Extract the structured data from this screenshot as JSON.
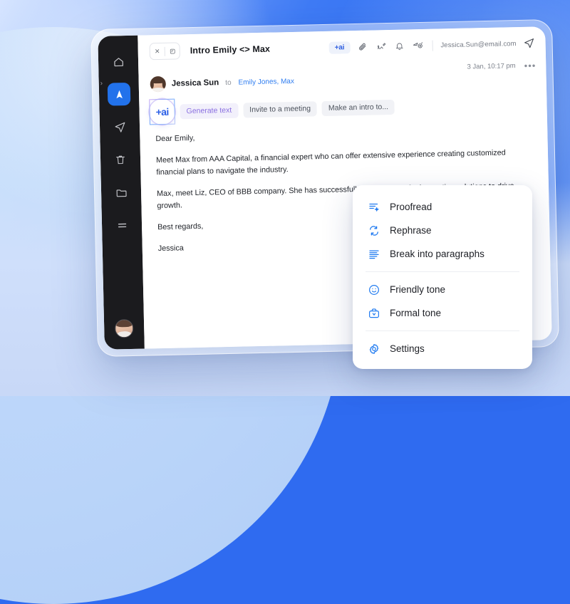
{
  "app": {
    "window_title": "Intro Emily <> Max"
  },
  "sidebar": {
    "items": [
      {
        "id": "home",
        "icon": "home-icon",
        "active": false
      },
      {
        "id": "inbox",
        "icon": "navigator-icon",
        "active": true
      },
      {
        "id": "sent",
        "icon": "send-icon",
        "active": false
      },
      {
        "id": "trash",
        "icon": "trash-icon",
        "active": false
      },
      {
        "id": "folders",
        "icon": "folder-icon",
        "active": false
      },
      {
        "id": "menu",
        "icon": "hamburger-menu-icon",
        "active": false
      }
    ],
    "caret": "›",
    "avatar_alt": "user-avatar"
  },
  "topbar": {
    "close_label": "✕",
    "collapse_icon": "collapse-icon",
    "title": "Intro Emily <> Max",
    "ai_badge": "+ai",
    "icons": [
      "attachment-icon",
      "signature-icon",
      "notification-bell-icon",
      "read-tracking-icon"
    ],
    "email": "Jessica.Sun@email.com",
    "send_icon": "send-icon"
  },
  "message": {
    "date": "3 Jan, 10:17 pm",
    "more": "•••",
    "sender": "Jessica Sun",
    "to_label": "to",
    "recipients": "Emily Jones, Max",
    "body": [
      "Dear Emily,",
      "Meet Max from AAA Capital, a financial expert who can offer extensive experience creating customized financial plans to navigate the industry.",
      "Max, meet Liz, CEO of BBB company. She has successfully been looking for innovative solutions to drive growth.",
      "Best regards,",
      "Jessica"
    ]
  },
  "chips": {
    "orb_label": "+ai",
    "items": [
      {
        "label": "Generate text",
        "style": "gen"
      },
      {
        "label": "Invite to a meeting",
        "style": "plain"
      },
      {
        "label": "Make an intro to...",
        "style": "plain"
      }
    ]
  },
  "dropdown": {
    "groups": [
      [
        {
          "label": "Proofread",
          "icon": "proofread-icon"
        },
        {
          "label": "Rephrase",
          "icon": "rephrase-icon"
        },
        {
          "label": "Break into paragraphs",
          "icon": "paragraphs-icon"
        }
      ],
      [
        {
          "label": "Friendly tone",
          "icon": "smiley-icon"
        },
        {
          "label": "Formal tone",
          "icon": "briefcase-icon"
        }
      ],
      [
        {
          "label": "Settings",
          "icon": "gear-icon"
        }
      ]
    ]
  },
  "colors": {
    "accent_blue": "#2272eb",
    "menu_icon_blue": "#1f7af0",
    "recipient_blue": "#2f7df0",
    "generate_purple": "#8a6fe0",
    "sidebar_dark": "#1b1b1e"
  }
}
